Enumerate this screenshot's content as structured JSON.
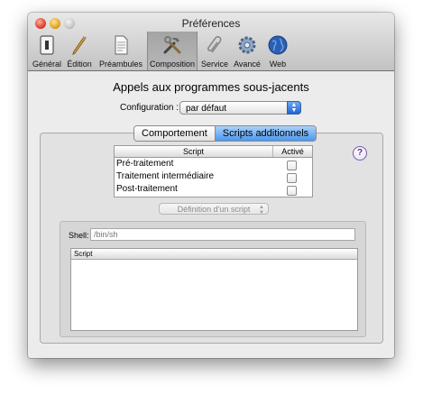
{
  "window": {
    "title": "Préférences"
  },
  "toolbar": {
    "items": [
      {
        "label": "Général",
        "icon": "general-switch-icon"
      },
      {
        "label": "Édition",
        "icon": "pencil-icon"
      },
      {
        "label": "Préambules",
        "icon": "document-icon"
      },
      {
        "label": "Composition",
        "icon": "tools-icon",
        "selected": true
      },
      {
        "label": "Service",
        "icon": "paperclip-icon"
      },
      {
        "label": "Avancé",
        "icon": "gear-icon"
      },
      {
        "label": "Web",
        "icon": "globe-icon"
      }
    ]
  },
  "main": {
    "heading": "Appels aux programmes sous-jacents",
    "configuration": {
      "label": "Configuration :",
      "value": "par défaut"
    },
    "tabs": [
      {
        "label": "Comportement",
        "active": false
      },
      {
        "label": "Scripts additionnels",
        "active": true
      }
    ],
    "help_label": "?",
    "scripts_table": {
      "headers": {
        "script": "Script",
        "active": "Activé"
      },
      "rows": [
        {
          "name": "Pré-traitement",
          "checked": false
        },
        {
          "name": "Traitement intermédiaire",
          "checked": false
        },
        {
          "name": "Post-traitement",
          "checked": false
        }
      ]
    },
    "definition_popup": {
      "label": "Définition d'un script"
    },
    "shell": {
      "label": "Shell:",
      "placeholder": "/bin/sh"
    },
    "script_area": {
      "header": "Script"
    }
  },
  "colors": {
    "accent": "#4c97ec",
    "traffic_close": "#e0442e",
    "traffic_minimize": "#e6a51d",
    "traffic_zoom": "#c8c8c8"
  }
}
